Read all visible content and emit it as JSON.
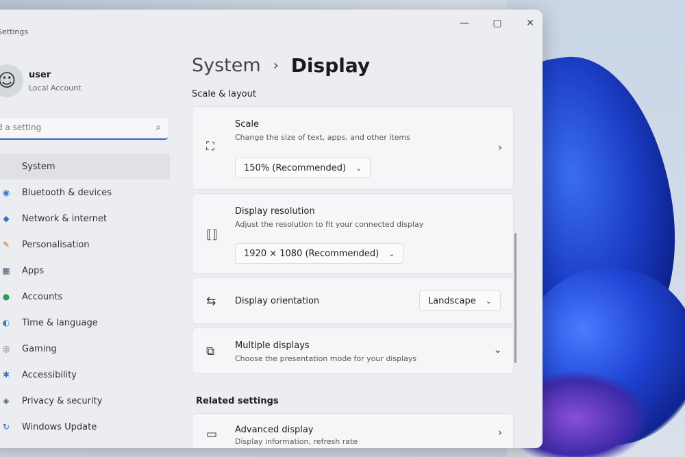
{
  "window": {
    "app_title": "Settings",
    "controls": {
      "minimize": "—",
      "maximize": "▢",
      "close": "✕"
    }
  },
  "user": {
    "name": "user",
    "account_type": "Local Account"
  },
  "search": {
    "placeholder": "d a setting"
  },
  "nav": [
    {
      "label": "System",
      "icon": "system-icon",
      "glyph": "▪",
      "color": "#2e5fbe"
    },
    {
      "label": "Bluetooth & devices",
      "icon": "bluetooth-icon",
      "glyph": "◉",
      "color": "#2e76d9"
    },
    {
      "label": "Network & internet",
      "icon": "network-icon",
      "glyph": "◆",
      "color": "#3a6fc4"
    },
    {
      "label": "Personalisation",
      "icon": "brush-icon",
      "glyph": "✎",
      "color": "#c86a2a"
    },
    {
      "label": "Apps",
      "icon": "apps-icon",
      "glyph": "▦",
      "color": "#4a5a78"
    },
    {
      "label": "Accounts",
      "icon": "accounts-icon",
      "glyph": "●",
      "color": "#2e9a5a"
    },
    {
      "label": "Time & language",
      "icon": "globe-icon",
      "glyph": "◐",
      "color": "#2e7fbe"
    },
    {
      "label": "Gaming",
      "icon": "gaming-icon",
      "glyph": "◎",
      "color": "#6a6f7a"
    },
    {
      "label": "Accessibility",
      "icon": "accessibility-icon",
      "glyph": "✱",
      "color": "#2e6fce"
    },
    {
      "label": "Privacy & security",
      "icon": "shield-icon",
      "glyph": "◈",
      "color": "#5a6070"
    },
    {
      "label": "Windows Update",
      "icon": "update-icon",
      "glyph": "↻",
      "color": "#2e6fce"
    }
  ],
  "breadcrumb": {
    "parent": "System",
    "separator": "›",
    "current": "Display"
  },
  "scale_layout": {
    "label": "Scale & layout",
    "scale": {
      "title": "Scale",
      "description": "Change the size of text, apps, and other items",
      "value": "150% (Recommended)"
    },
    "resolution": {
      "title": "Display resolution",
      "description": "Adjust the resolution to fit your connected display",
      "value": "1920 × 1080 (Recommended)"
    },
    "orientation": {
      "title": "Display orientation",
      "value": "Landscape"
    },
    "multiple": {
      "title": "Multiple displays",
      "description": "Choose the presentation mode for your displays"
    }
  },
  "related": {
    "label": "Related settings",
    "advanced": {
      "title": "Advanced display",
      "description": "Display information, refresh rate"
    }
  }
}
